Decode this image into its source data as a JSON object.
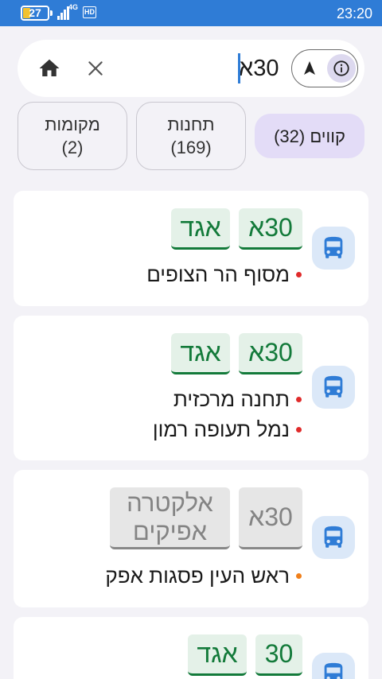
{
  "status_bar": {
    "battery": "27",
    "network": "4G",
    "hd": "HD",
    "time": "23:20"
  },
  "search": {
    "query": "30א",
    "icons": {
      "home": "home-icon",
      "clear": "close-icon",
      "navigate": "navigation-arrow-icon",
      "info": "info-icon"
    }
  },
  "tabs": {
    "lines": "קווים (32)",
    "stations_name": "תחנות",
    "stations_count": "(169)",
    "places_name": "מקומות",
    "places_count": "(2)"
  },
  "results": [
    {
      "line": "30א",
      "operator": "אגד",
      "operator_color": "#137a3a",
      "stops": [
        "מסוף הר הצופים"
      ],
      "dot_color": "#e02b2b"
    },
    {
      "line": "30א",
      "operator": "אגד",
      "operator_color": "#137a3a",
      "stops": [
        "תחנה מרכזית",
        "נמל תעופה רמון"
      ],
      "dot_color": "#e02b2b"
    },
    {
      "line": "30א",
      "operator_line1": "אלקטרה",
      "operator_line2": "אפיקים",
      "operator_color": "#848484",
      "stops": [
        "ראש העין פסגות אפק"
      ],
      "dot_color": "#f07f1a"
    },
    {
      "line": "30",
      "operator": "אגד",
      "operator_color": "#137a3a"
    }
  ],
  "colors": {
    "status_bar": "#2f7cd6",
    "accent": "#2f7cd6",
    "selected_tab": "#e3dcf7"
  }
}
